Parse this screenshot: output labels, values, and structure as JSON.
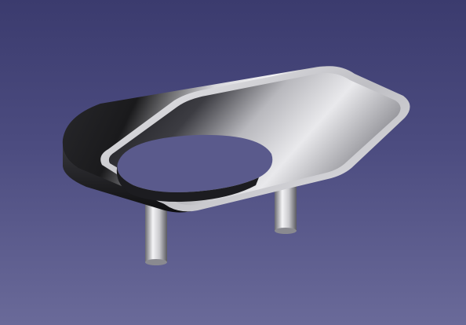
{
  "viewport": {
    "background_top": "#3b3b6e",
    "background_mid": "#4c4c80",
    "background_bottom": "#6a6a99"
  },
  "model": {
    "icon": "3d-part-model",
    "parts": [
      "shell",
      "rim",
      "cutout",
      "leg-left",
      "leg-right"
    ],
    "colors": {
      "dark_shade": "#1e1e22",
      "mid_shade": "#6e6e73",
      "light_shade": "#e6e6e8",
      "rim": "#cfcfd3"
    }
  }
}
